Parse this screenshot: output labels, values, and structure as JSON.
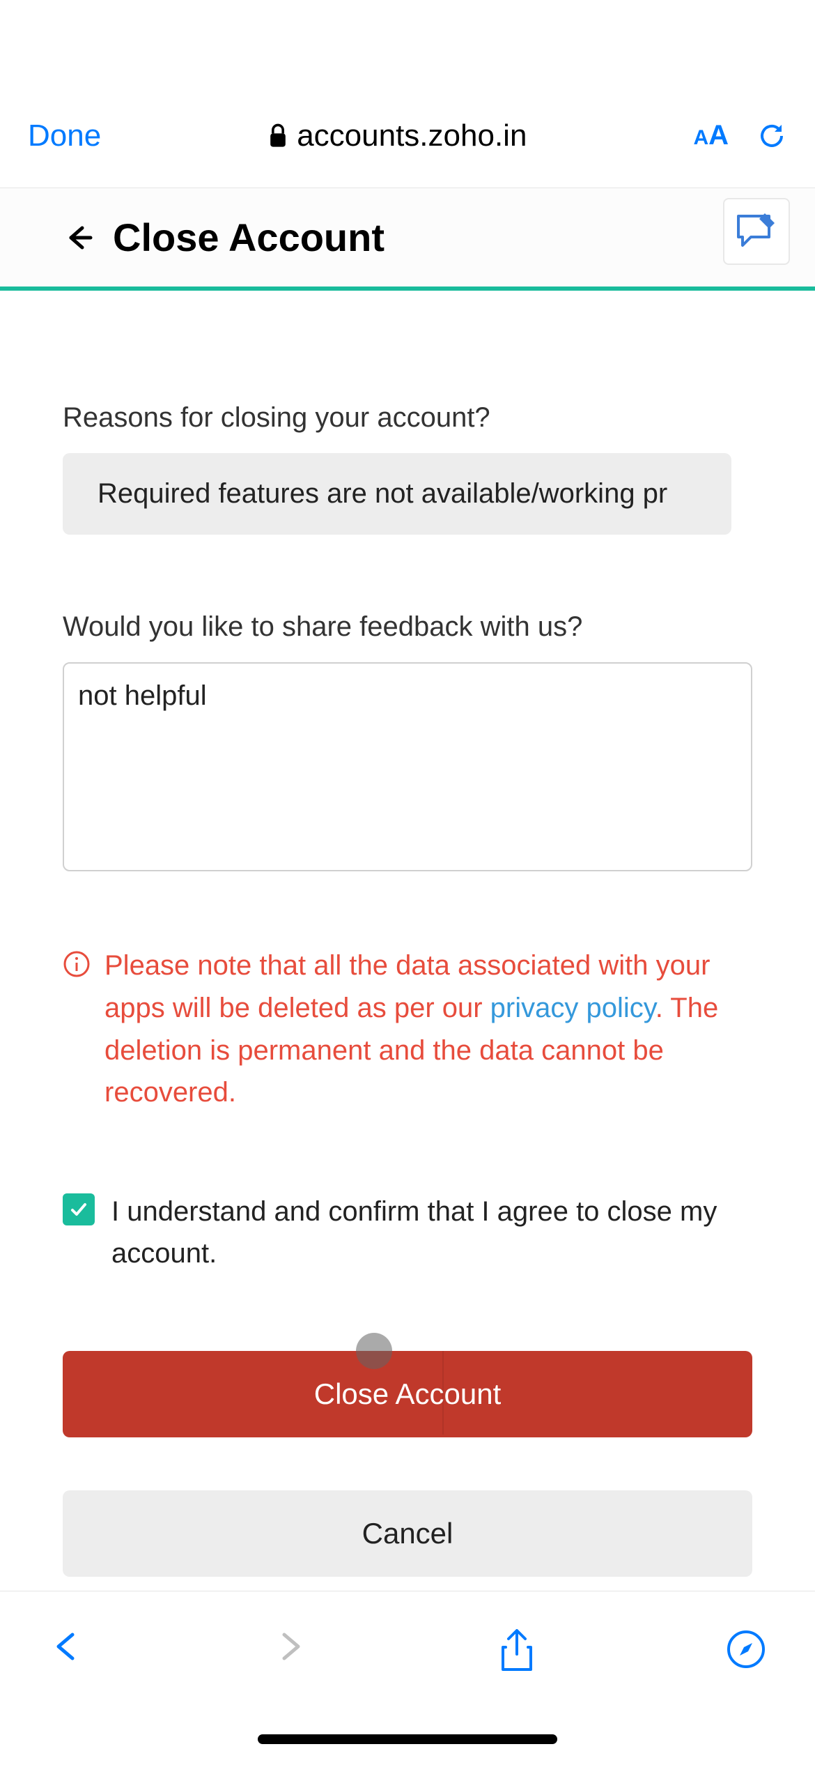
{
  "browser": {
    "done": "Done",
    "url": "accounts.zoho.in"
  },
  "header": {
    "title": "Close Account"
  },
  "partial_heading": "Close Account",
  "form": {
    "reason_label": "Reasons for closing your account?",
    "reason_value": "Required features are not available/working pr",
    "feedback_label": "Would you like to share feedback with us?",
    "feedback_value": "not helpful",
    "warning_text_1": "Please note that all the data associated with your apps will be deleted as per our ",
    "warning_link": "privacy policy",
    "warning_text_2": ". The deletion is permanent and the data cannot be recovered.",
    "confirm_text": "I understand and confirm that I agree to close my account.",
    "confirm_checked": true,
    "primary_button": "Close Account",
    "secondary_button": "Cancel"
  }
}
